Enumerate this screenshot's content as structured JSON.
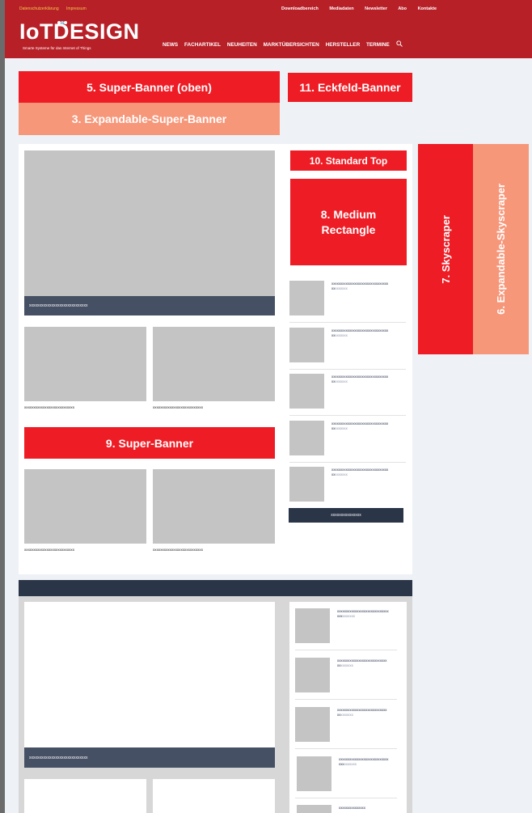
{
  "header": {
    "util_left": [
      "Datenschutzerklärung",
      "Impressum"
    ],
    "util_right": [
      "Downloadbereich",
      "Mediadaten",
      "Newsletter",
      "Abo",
      "Kontakte"
    ],
    "logo_text": "IoTDESIGN",
    "logo_tagline": "Smarte Systeme für das Internet of Things",
    "nav": [
      "NEWS",
      "FACHARTIKEL",
      "NEUHEITEN",
      "MARKTÜBERSICHTEN",
      "HERSTELLER",
      "TERMINE"
    ],
    "search_icon": "search-icon"
  },
  "ads": {
    "super_banner_top": "5. Super-Banner (oben)",
    "eckfeld": "11. Eckfeld-Banner",
    "expandable_super": "3. Expandable-Super-Banner",
    "standard_top": "10. Standard Top",
    "medium_rectangle": "8. Medium Rectangle",
    "skyscraper": "7. Skyscraper",
    "expandable_skyscraper": "6. Expandable-Skyscraper",
    "super_banner_mid": "9. Super-Banner"
  },
  "main": {
    "hero_caption": "xxxxxxxxxxxxxxxxxxxxxxxxxxxxx",
    "grid_captions": [
      "xxxxxxxxxxxxxxxxxxxxxxxxxxx",
      "xxxxxxxxxxxxxxxxxxxxxxxxxxx",
      "xxxxxxxxxxxxxxxxxxxxxxxxxxx",
      "xxxxxxxxxxxxxxxxxxxxxxxxxxx"
    ],
    "side_items": [
      {
        "title": "xxxxxxxxxxxxxxxxxxxxxxxxxxxxxxxx",
        "title2": "xx",
        "sub": "xxxxxxx"
      },
      {
        "title": "xxxxxxxxxxxxxxxxxxxxxxxxxxxxxxxx",
        "title2": "xx",
        "sub": "xxxxxxx"
      },
      {
        "title": "xxxxxxxxxxxxxxxxxxxxxxxxxxxxxxxx",
        "title2": "xx",
        "sub": "xxxxxxx"
      },
      {
        "title": "xxxxxxxxxxxxxxxxxxxxxxxxxxxxxxxx",
        "title2": "xx",
        "sub": "xxxxxxx"
      },
      {
        "title": "xxxxxxxxxxxxxxxxxxxxxxxxxxxxxxxx",
        "title2": "xx",
        "sub": "xxxxxxx"
      }
    ],
    "side_button": "xxxxxxxxxxxxxxx"
  },
  "lower": {
    "hero_caption": "xxxxxxxxxxxxxxxxxxxxxxxxxxxxx",
    "side_items": [
      {
        "title": "xxxxxxxxxxxxxxxxxxxxxxxxxxxxx",
        "title2": "xxx",
        "sub": "xxxxxxx"
      },
      {
        "title": "xxxxxxxxxxxxxxxxxxxxxxxxxxxx",
        "title2": "xx",
        "sub": "xxxxxxx"
      },
      {
        "title": "xxxxxxxxxxxxxxxxxxxxxxxxxxxx",
        "title2": "xx",
        "sub": "xxxxxxx"
      },
      {
        "title": "xxxxxxxxxxxxxxxxxxxxxxxxxxxx",
        "title2": "xxx",
        "sub": "xxxxxxx"
      }
    ],
    "last_item": "xxxxxxxxxxxxxxx"
  },
  "colors": {
    "header_red": "#b82028",
    "ad_red": "#ee1c25",
    "ad_salmon": "#f7977a",
    "navy": "#2b3548",
    "slate": "#465064"
  }
}
